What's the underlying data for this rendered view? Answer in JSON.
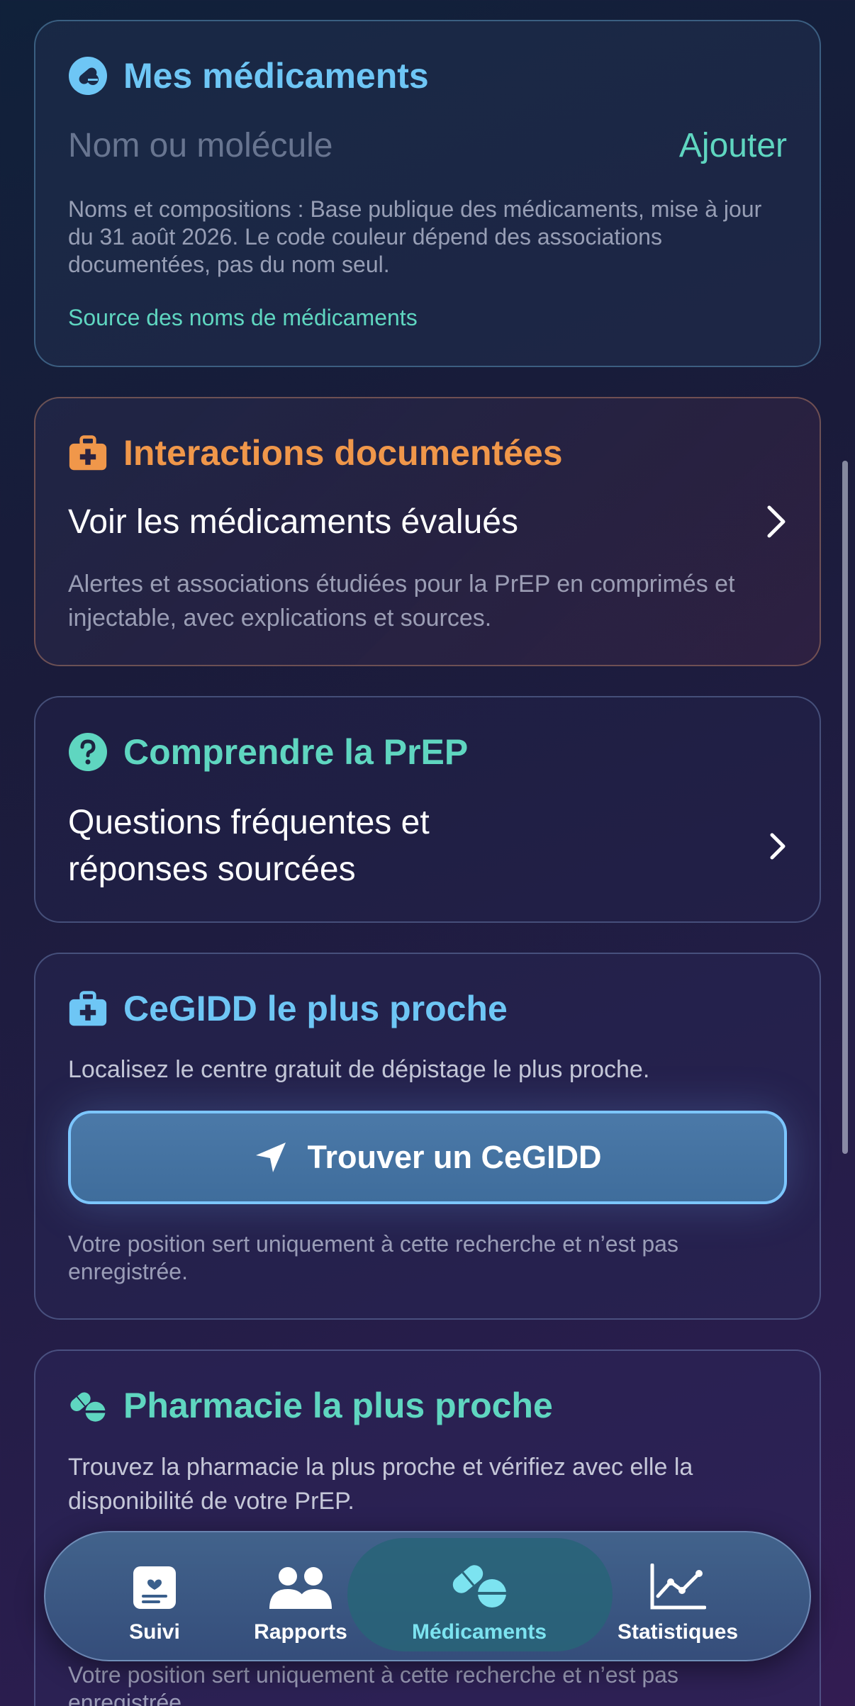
{
  "meds": {
    "title": "Mes médicaments",
    "input_placeholder": "Nom ou molécule",
    "add_label": "Ajouter",
    "note": "Noms et compositions : Base publique des médicaments, mise à jour du 31 août 2026. Le code couleur dépend des associations documentées, pas du nom seul.",
    "source_link": "Source des noms de médicaments"
  },
  "interactions": {
    "title": "Interactions documentées",
    "row_label": "Voir les médicaments évalués",
    "description": "Alertes et associations étudiées pour la PrEP en comprimés et injectable, avec explications et sources."
  },
  "understand": {
    "title": "Comprendre la PrEP",
    "row_label_line1": "Questions fréquentes et",
    "row_label_line2": "réponses sourcées"
  },
  "cegidd": {
    "title": "CeGIDD le plus proche",
    "description": "Localisez le centre gratuit de dépistage le plus proche.",
    "button_label": "Trouver un CeGIDD",
    "privacy_line1": "Votre position sert uniquement à cette recherche et n’est pas",
    "privacy_line2": "enregistrée."
  },
  "pharmacy": {
    "title": "Pharmacie la plus proche",
    "description_line1": "Trouvez la pharmacie la plus proche et vérifiez avec elle la",
    "description_line2": "disponibilité de votre PrEP.",
    "privacy_line1": "Votre position sert uniquement à cette recherche et n’est pas",
    "privacy_line2": "enregistrée."
  },
  "tabs": [
    {
      "label": "Suivi",
      "icon": "clipboard-heart-icon",
      "active": false
    },
    {
      "label": "Rapports",
      "icon": "people-icon",
      "active": false
    },
    {
      "label": "Médicaments",
      "icon": "pills-icon",
      "active": true
    },
    {
      "label": "Statistiques",
      "icon": "chart-line-icon",
      "active": false
    }
  ],
  "colors": {
    "blue_accent": "#6ec6f5",
    "orange_accent": "#f0974a",
    "teal_accent": "#5fd6c0",
    "active_tab": "#7ce3f0"
  }
}
